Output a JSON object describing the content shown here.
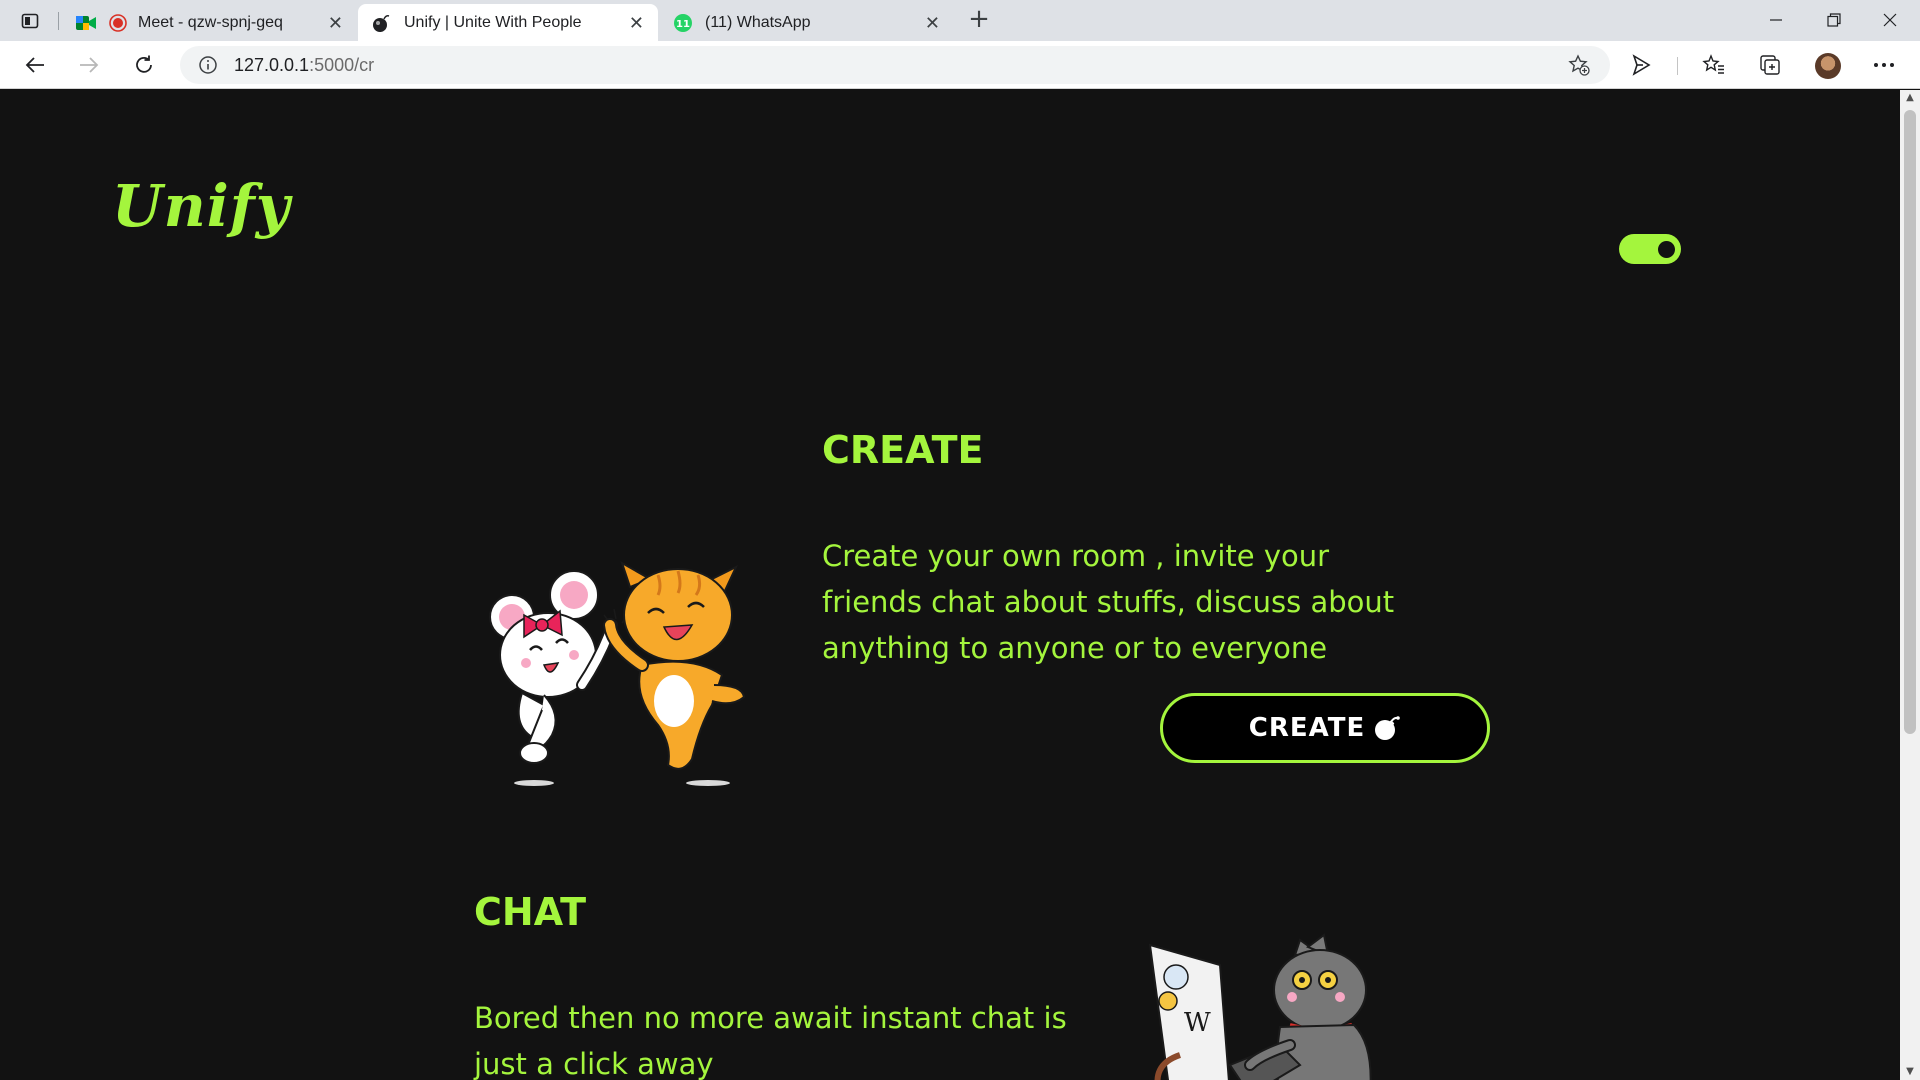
{
  "browser": {
    "tabs": [
      {
        "title": "Meet - qzw-spnj-geq",
        "icon": "google-meet-icon",
        "active": false
      },
      {
        "title": "Unify | Unite With People",
        "icon": "bomb-icon",
        "active": true
      },
      {
        "title": "(11) WhatsApp",
        "icon": "whatsapp-icon",
        "active": false,
        "badge": "11"
      }
    ],
    "url_host": "127.0.0.1",
    "url_path": ":5000/cr"
  },
  "page": {
    "logo": "Unify",
    "theme_toggle": "on",
    "create": {
      "heading": "CREATE",
      "description": "Create your own room , invite your friends chat about stuffs, discuss about anything to anyone or to everyone",
      "button_label": "CREATE"
    },
    "chat": {
      "heading": "CHAT",
      "description": "Bored then no more await instant chat is just a click away"
    }
  },
  "colors": {
    "accent": "#a4f53d",
    "background": "#121212",
    "button_bg": "#000000"
  }
}
